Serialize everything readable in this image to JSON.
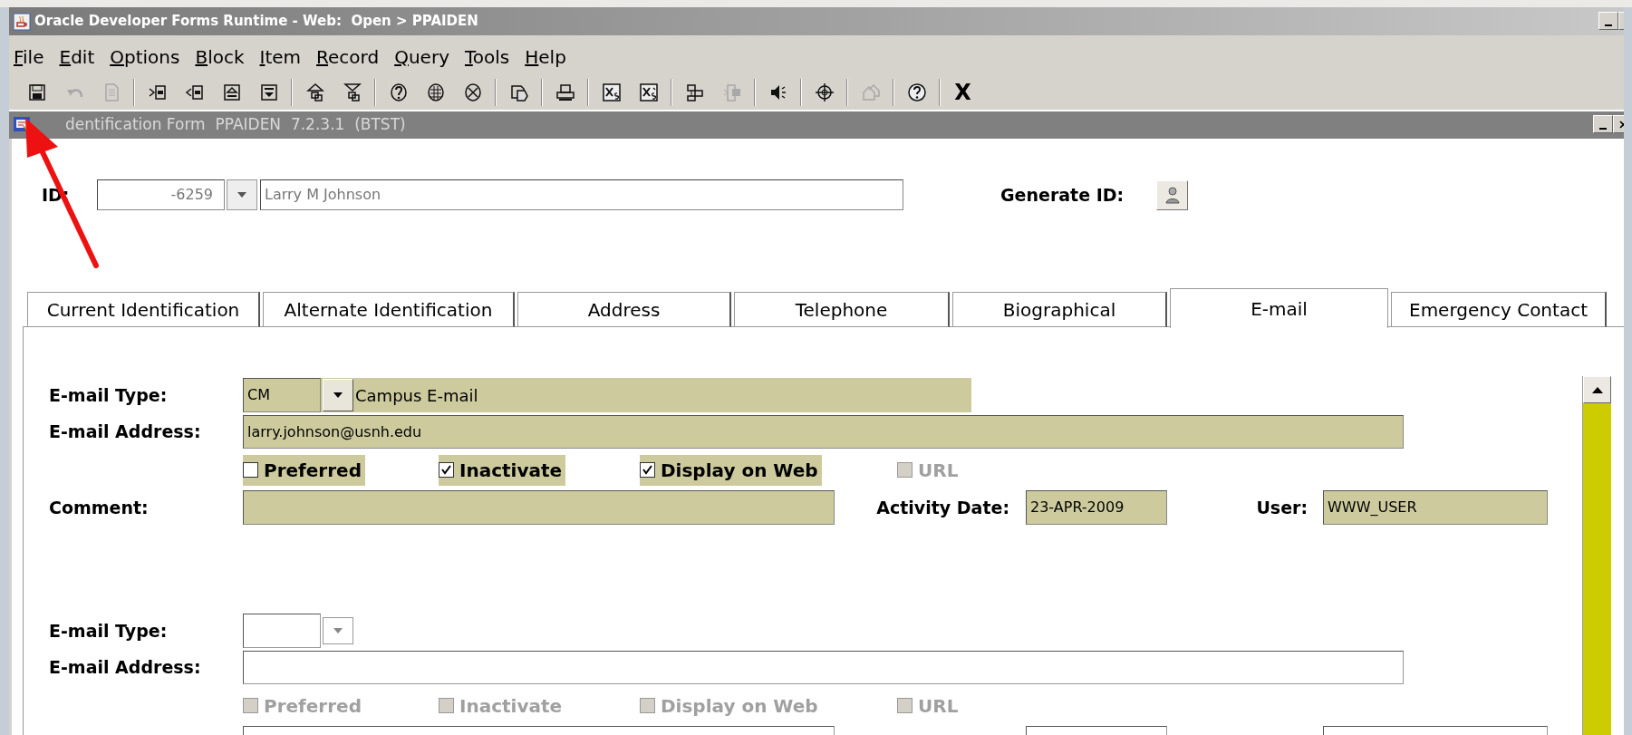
{
  "window": {
    "title": "Oracle Developer Forms Runtime - Web:  Open > PPAIDEN"
  },
  "menu": [
    "File",
    "Edit",
    "Options",
    "Block",
    "Item",
    "Record",
    "Query",
    "Tools",
    "Help"
  ],
  "toolbar": [
    [
      {
        "kind": "save",
        "disabled": false
      },
      {
        "kind": "undo",
        "disabled": true
      },
      {
        "kind": "page",
        "disabled": true
      }
    ],
    [
      {
        "kind": "prev-block",
        "disabled": false
      },
      {
        "kind": "next-block",
        "disabled": false
      },
      {
        "kind": "prev-record",
        "disabled": false
      },
      {
        "kind": "next-record",
        "disabled": false
      }
    ],
    [
      {
        "kind": "insert",
        "disabled": false
      },
      {
        "kind": "delete",
        "disabled": false
      }
    ],
    [
      {
        "kind": "query",
        "disabled": false
      },
      {
        "kind": "execute",
        "disabled": false
      },
      {
        "kind": "cancel",
        "disabled": false
      }
    ],
    [
      {
        "kind": "copy",
        "disabled": false
      }
    ],
    [
      {
        "kind": "print",
        "disabled": false
      }
    ],
    [
      {
        "kind": "xs",
        "disabled": false
      },
      {
        "kind": "xs2",
        "disabled": false
      }
    ],
    [
      {
        "kind": "tree",
        "disabled": false
      },
      {
        "kind": "tree2",
        "disabled": true
      }
    ],
    [
      {
        "kind": "speaker",
        "disabled": false
      }
    ],
    [
      {
        "kind": "target",
        "disabled": false
      }
    ],
    [
      {
        "kind": "home",
        "disabled": true
      }
    ],
    [
      {
        "kind": "help",
        "disabled": false
      }
    ],
    [
      {
        "kind": "text",
        "label": "X",
        "disabled": false
      }
    ]
  ],
  "form": {
    "title": "dentification Form  PPAIDEN  7.2.3.1  (BTST)",
    "id_label": "ID:",
    "id_value": "-6259",
    "name_value": "Larry M Johnson",
    "generate_label": "Generate ID:"
  },
  "tabs": [
    {
      "label": "Current Identification",
      "selected": false
    },
    {
      "label": "Alternate Identification",
      "selected": false
    },
    {
      "label": "Address",
      "selected": false
    },
    {
      "label": "Telephone",
      "selected": false
    },
    {
      "label": "Biographical",
      "selected": false
    },
    {
      "label": "E-mail",
      "selected": true
    },
    {
      "label": "Emergency Contact",
      "selected": false
    }
  ],
  "records": [
    {
      "active": true,
      "rows": [
        {
          "kind": "type",
          "label": "E-mail Type:",
          "code": "CM",
          "description": "Campus E-mail"
        },
        {
          "kind": "address",
          "label": "E-mail Address:",
          "value": "larry.johnson@usnh.edu"
        },
        {
          "kind": "checkboxes",
          "items": [
            {
              "label": "Preferred",
              "checked": false,
              "disabled": false
            },
            {
              "label": "Inactivate",
              "checked": true,
              "disabled": false
            },
            {
              "label": "Display on Web",
              "checked": true,
              "disabled": false
            },
            {
              "label": "URL",
              "checked": false,
              "disabled": true
            }
          ]
        },
        {
          "kind": "comment",
          "label": "Comment:",
          "date_label": "Activity Date:",
          "date": "23-APR-2009",
          "user_label": "User:",
          "user": "WWW_USER"
        }
      ]
    },
    {
      "active": false,
      "rows": [
        {
          "kind": "type",
          "label": "E-mail Type:"
        },
        {
          "kind": "address",
          "label": "E-mail Address:"
        },
        {
          "kind": "checkboxes",
          "items": [
            {
              "label": "Preferred",
              "checked": false,
              "disabled": true
            },
            {
              "label": "Inactivate",
              "checked": false,
              "disabled": true
            },
            {
              "label": "Display on Web",
              "checked": false,
              "disabled": true
            },
            {
              "label": "URL",
              "checked": false,
              "disabled": true
            }
          ]
        },
        {
          "kind": "comment"
        }
      ]
    }
  ],
  "annotation_arrow": true
}
